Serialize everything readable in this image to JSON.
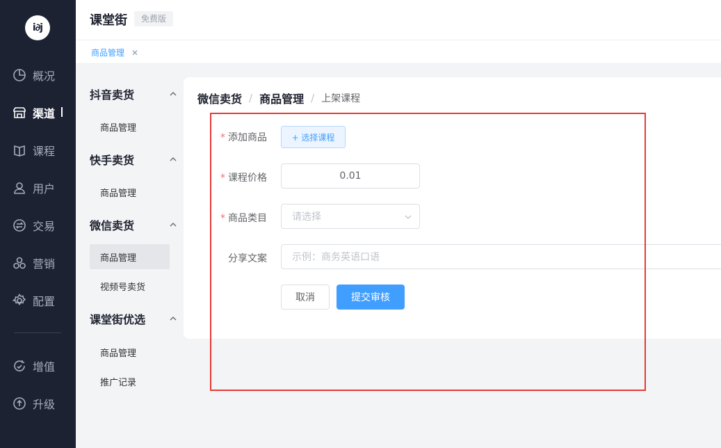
{
  "app": {
    "title": "课堂街",
    "edition": "免费版",
    "logo_text": "i∂j"
  },
  "rail": {
    "items": [
      {
        "label": "概况",
        "icon": "pie-chart-icon"
      },
      {
        "label": "渠道",
        "icon": "store-icon"
      },
      {
        "label": "课程",
        "icon": "book-icon"
      },
      {
        "label": "用户",
        "icon": "user-icon"
      },
      {
        "label": "交易",
        "icon": "exchange-icon"
      },
      {
        "label": "营销",
        "icon": "marketing-icon"
      },
      {
        "label": "配置",
        "icon": "gear-icon"
      },
      {
        "label": "增值",
        "icon": "value-added-icon"
      },
      {
        "label": "升级",
        "icon": "upgrade-icon"
      }
    ],
    "active": "渠道"
  },
  "tabs": [
    {
      "label": "商品管理"
    }
  ],
  "subnav": {
    "groups": [
      {
        "label": "抖音卖货",
        "items": [
          "商品管理"
        ]
      },
      {
        "label": "快手卖货",
        "items": [
          "商品管理"
        ]
      },
      {
        "label": "微信卖货",
        "items": [
          "商品管理",
          "视频号卖货"
        ]
      },
      {
        "label": "课堂街优选",
        "items": [
          "商品管理",
          "推广记录"
        ]
      }
    ],
    "active_item": "微信卖货/商品管理"
  },
  "breadcrumb": [
    "微信卖货",
    "商品管理",
    "上架课程"
  ],
  "form": {
    "add_product_label": "添加商品",
    "select_course_button": "+ 选择课程",
    "price_label": "课程价格",
    "price_value": "0.01",
    "category_label": "商品类目",
    "category_placeholder": "请选择",
    "share_label": "分享文案",
    "share_placeholder": "示例：商务英语口语",
    "cancel_button": "取消",
    "submit_button": "提交审核"
  },
  "colors": {
    "rail_bg": "#1c2232",
    "primary": "#409eff",
    "required": "#f56c6c",
    "highlight": "#e53935"
  }
}
